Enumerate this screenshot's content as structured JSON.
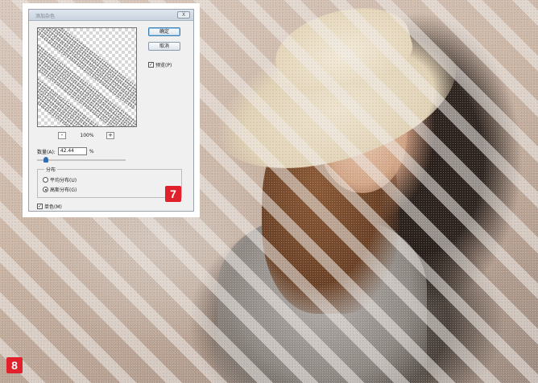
{
  "dialog": {
    "title": "添加杂色",
    "close_label": "X",
    "ok_label": "确定",
    "cancel_label": "取消",
    "preview_label": "预览(P)",
    "preview_checked": true,
    "zoom_out_label": "-",
    "zoom_in_label": "+",
    "zoom_value": "100%",
    "amount_label": "数量(A):",
    "amount_value": "42.44",
    "amount_unit": "%",
    "amount_slider_fraction": 0.1,
    "distribution_legend": "分布",
    "distribution_options": [
      {
        "label": "平均分布(U)",
        "selected": false
      },
      {
        "label": "高斯分布(G)",
        "selected": true
      }
    ],
    "monochrome_label": "单色(M)",
    "monochrome_checked": true
  },
  "badges": {
    "step_7": "7",
    "step_8": "8",
    "color": "#e0202a"
  },
  "icons": {
    "close": "close-icon",
    "checkbox": "checkbox-icon"
  }
}
